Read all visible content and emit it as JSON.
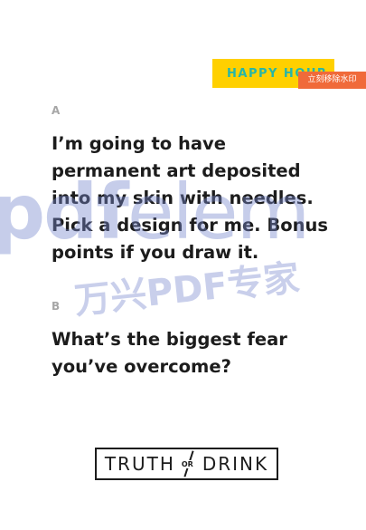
{
  "tag": "HAPPY HOUR",
  "watermark_action": "立刻移除水印",
  "cards": [
    {
      "letter": "A",
      "text": "I’m going to have permanent art deposited into my skin with needles. Pick a design for me. Bonus points if you draw it."
    },
    {
      "letter": "B",
      "text": "What’s the biggest fear you’ve overcome?"
    }
  ],
  "watermark": {
    "brand_a": "pdf",
    "brand_b": "elem",
    "cn": "万兴PDF专家"
  },
  "logo": {
    "left": "TRUTH",
    "mid": "OR",
    "right": "DRINK"
  },
  "colors": {
    "tag_bg": "#ffd000",
    "tag_text": "#27b6a8",
    "question": "#1c1c1c",
    "letter": "#a6a6a6",
    "remove_bg": "#f06a3a"
  }
}
